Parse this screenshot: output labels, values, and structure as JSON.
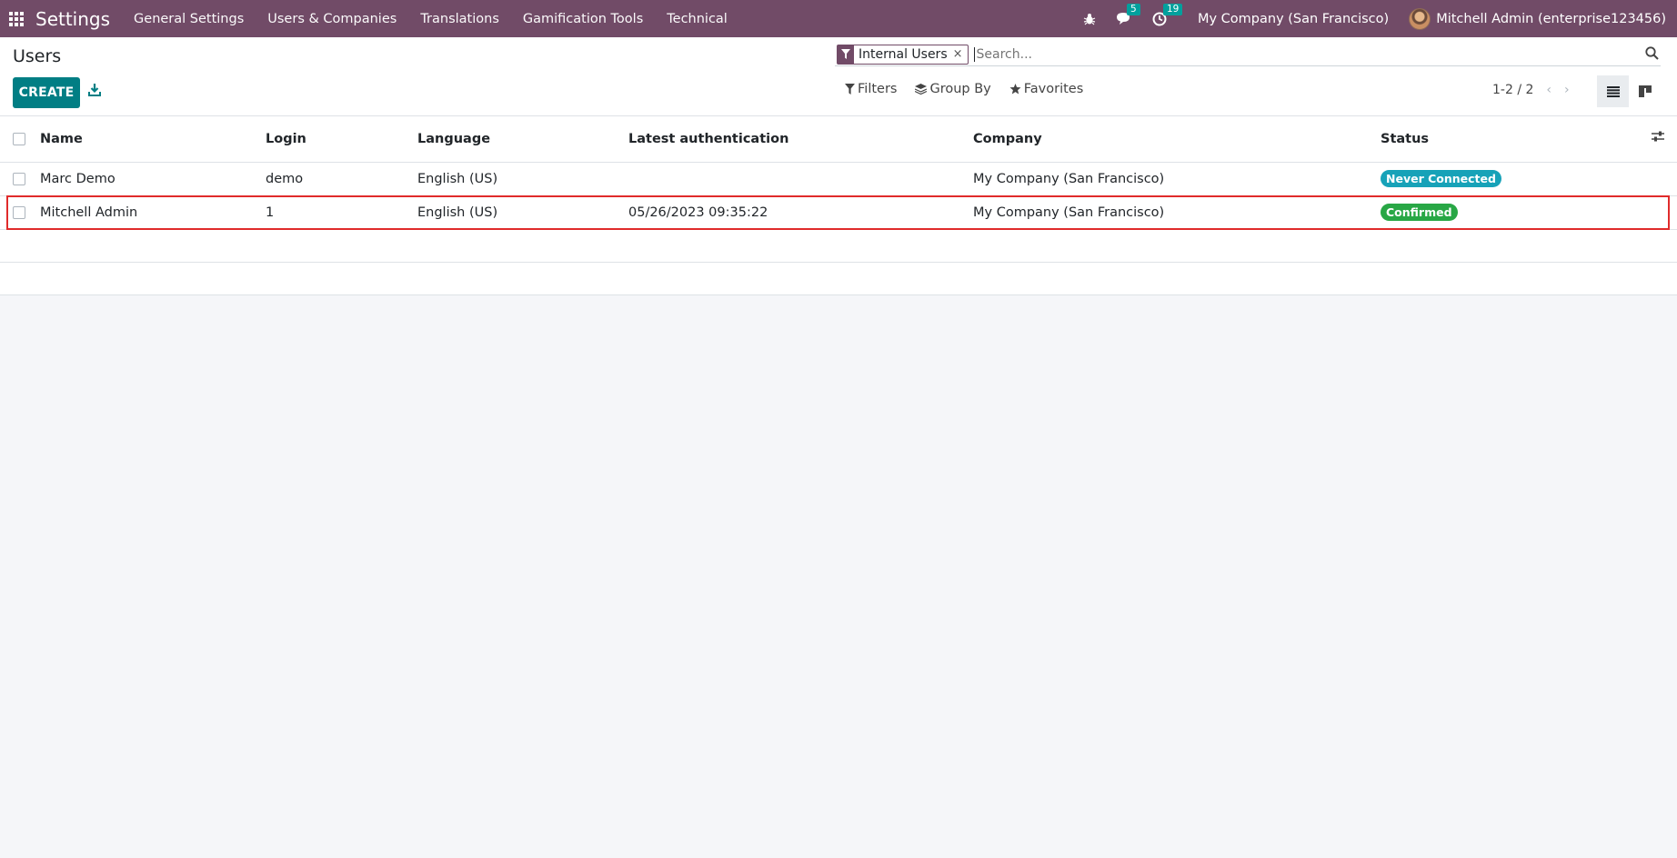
{
  "navbar": {
    "app_name": "Settings",
    "menu": [
      "General Settings",
      "Users & Companies",
      "Translations",
      "Gamification Tools",
      "Technical"
    ],
    "messages_count": "5",
    "activities_count": "19",
    "company": "My Company (San Francisco)",
    "user": "Mitchell Admin (enterprise123456)",
    "bg_color": "#714b67"
  },
  "control_panel": {
    "title": "Users",
    "create_label": "CREATE",
    "facet_label": "Internal Users",
    "facet_remove": "×",
    "search_placeholder": "Search...",
    "filters_label": "Filters",
    "groupby_label": "Group By",
    "favorites_label": "Favorites",
    "pager": "1-2 / 2",
    "prev": "‹",
    "next": "›"
  },
  "table": {
    "columns": [
      "Name",
      "Login",
      "Language",
      "Latest authentication",
      "Company",
      "Status"
    ],
    "rows": [
      {
        "name": "Marc Demo",
        "login": "demo",
        "language": "English (US)",
        "latest_auth": "",
        "company": "My Company (San Francisco)",
        "status": "Never Connected",
        "status_color": "#17a2b8"
      },
      {
        "name": "Mitchell Admin",
        "login": "1",
        "language": "English (US)",
        "latest_auth": "05/26/2023 09:35:22",
        "company": "My Company (San Francisco)",
        "status": "Confirmed",
        "status_color": "#28a745"
      }
    ]
  }
}
